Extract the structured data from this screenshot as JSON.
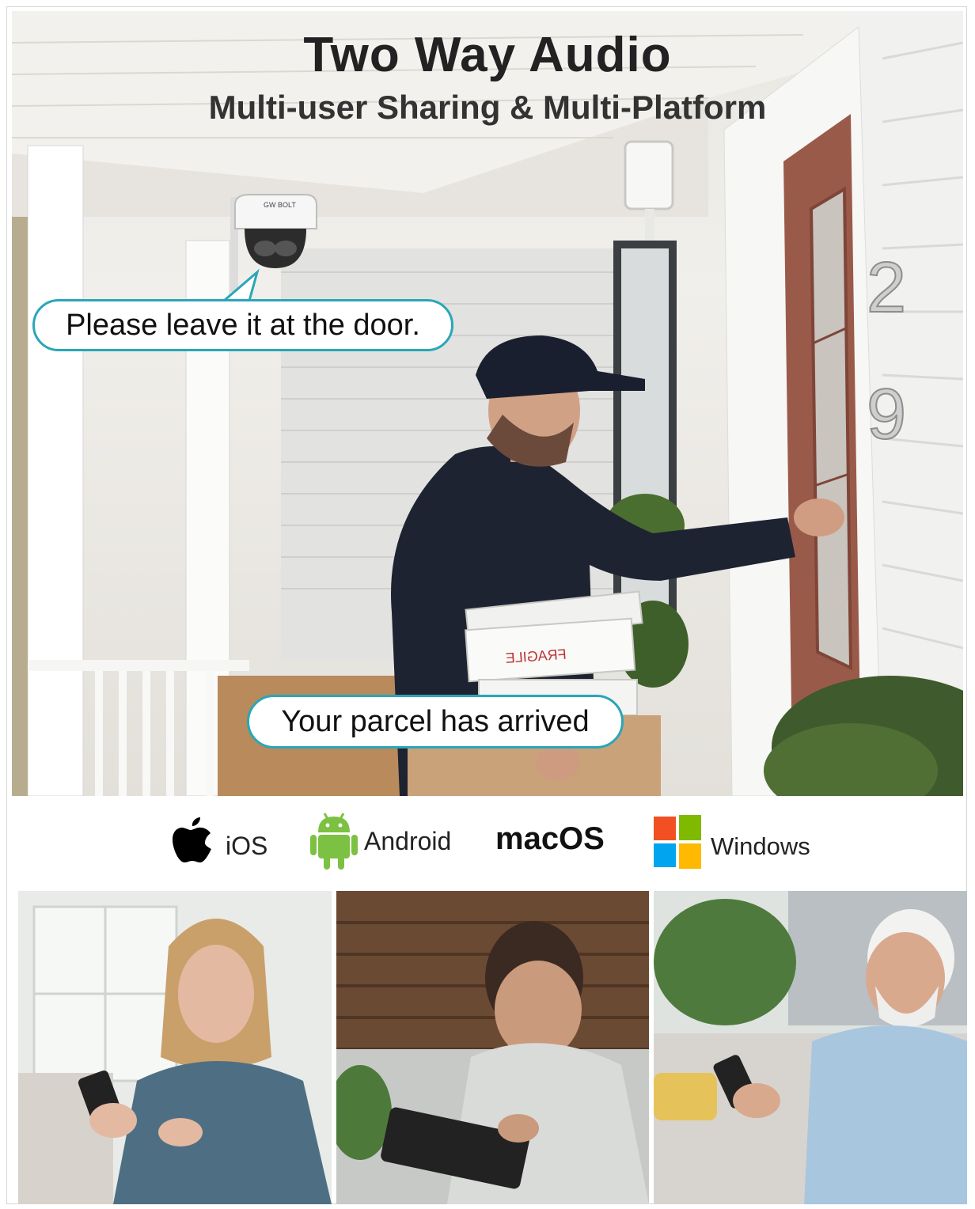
{
  "header": {
    "title": "Two Way Audio",
    "subtitle": "Multi-user Sharing & Multi-Platform"
  },
  "scene": {
    "camera_brand": "GW BOLT",
    "house_number": "29",
    "box_label": "FRAGILE"
  },
  "bubbles": [
    {
      "text": "Please leave it at the door."
    },
    {
      "text": "Your parcel has arrived"
    }
  ],
  "platforms": [
    {
      "icon": "apple-icon",
      "label": "iOS"
    },
    {
      "icon": "android-icon",
      "label": "Android"
    },
    {
      "icon": "",
      "label": "macOS"
    },
    {
      "icon": "windows-icon",
      "label": "Windows"
    }
  ],
  "photos": [
    {
      "subject": "woman-with-phone"
    },
    {
      "subject": "man-with-tablet"
    },
    {
      "subject": "older-man-with-phone"
    }
  ],
  "colors": {
    "bubble_border": "#2aa6b8",
    "android_green": "#7cc142",
    "windows_red": "#f25022",
    "windows_green": "#7fba00",
    "windows_blue": "#00a4ef",
    "windows_yellow": "#ffb900"
  }
}
